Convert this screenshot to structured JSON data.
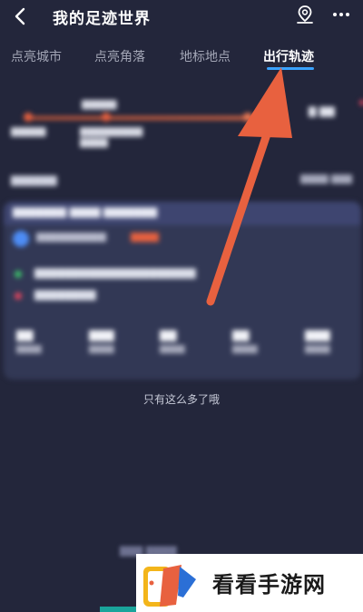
{
  "header": {
    "title": "我的足迹世界",
    "back_icon": "chevron-left-icon",
    "location_icon": "map-pin-icon",
    "more_icon": "more-horizontal-icon"
  },
  "tabs": [
    {
      "label": "点亮城市",
      "active": false
    },
    {
      "label": "点亮角落",
      "active": false
    },
    {
      "label": "地标地点",
      "active": false
    },
    {
      "label": "出行轨迹",
      "active": true
    }
  ],
  "footer_note": "只有这么多了哦",
  "watermark": {
    "text": "看看手游网"
  },
  "colors": {
    "background": "#23263b",
    "accent_tab": "#3aa3ff",
    "arrow": "#e8613f",
    "card": "#323855"
  }
}
